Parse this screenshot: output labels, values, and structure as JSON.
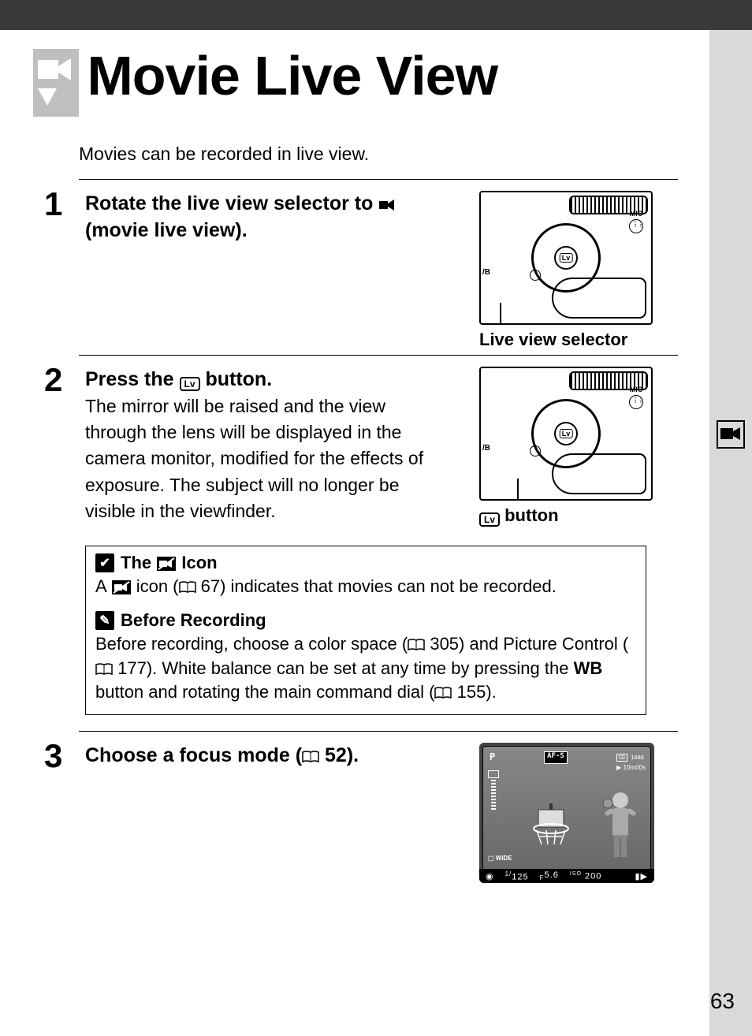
{
  "page": {
    "title": "Movie Live View",
    "intro": "Movies can be recorded in live view.",
    "number": "63"
  },
  "steps": [
    {
      "num": "1",
      "head_pre": "Rotate the live view selector to ",
      "head_post": " (movie live view).",
      "body": "",
      "caption": "Live view selector"
    },
    {
      "num": "2",
      "head_pre": "Press the ",
      "head_post": " button.",
      "body": "The mirror will be raised and the view through the lens will be displayed in the camera monitor, modified for the effects of exposure.  The subject will no longer be visible in the viewfinder.",
      "caption_post": " button"
    },
    {
      "num": "3",
      "head_pre": "Choose a focus mode (",
      "head_ref": " 52",
      "head_post": ").",
      "body": ""
    }
  ],
  "notes": {
    "icon_title_pre": "The ",
    "icon_title_post": " Icon",
    "icon_text_pre": "A ",
    "icon_text_mid": " icon (",
    "icon_text_ref": " 67",
    "icon_text_post": ") indicates that movies can not be recorded.",
    "before_title": "Before Recording",
    "before_text_1": "Before recording, choose a color space (",
    "before_ref_1": " 305",
    "before_text_2": ") and Picture Control (",
    "before_ref_2": " 177",
    "before_text_3": ").  White balance can be set at any time by pressing the ",
    "before_wb": "WB",
    "before_text_4": " button and rotating the main command dial (",
    "before_ref_3": " 155",
    "before_text_5": ")."
  },
  "monitor": {
    "mode": "P",
    "af": "AF-S",
    "card": "SD",
    "time": "10m00s",
    "wide": "WIDE",
    "shutter_pre": "1/",
    "shutter": "125",
    "aperture_pre": "F",
    "aperture": "5.6",
    "iso_pre": "ISO",
    "iso": "200"
  },
  "illus_labels": {
    "mic": "MIC",
    "wb": "/B",
    "lv": "Lv"
  }
}
